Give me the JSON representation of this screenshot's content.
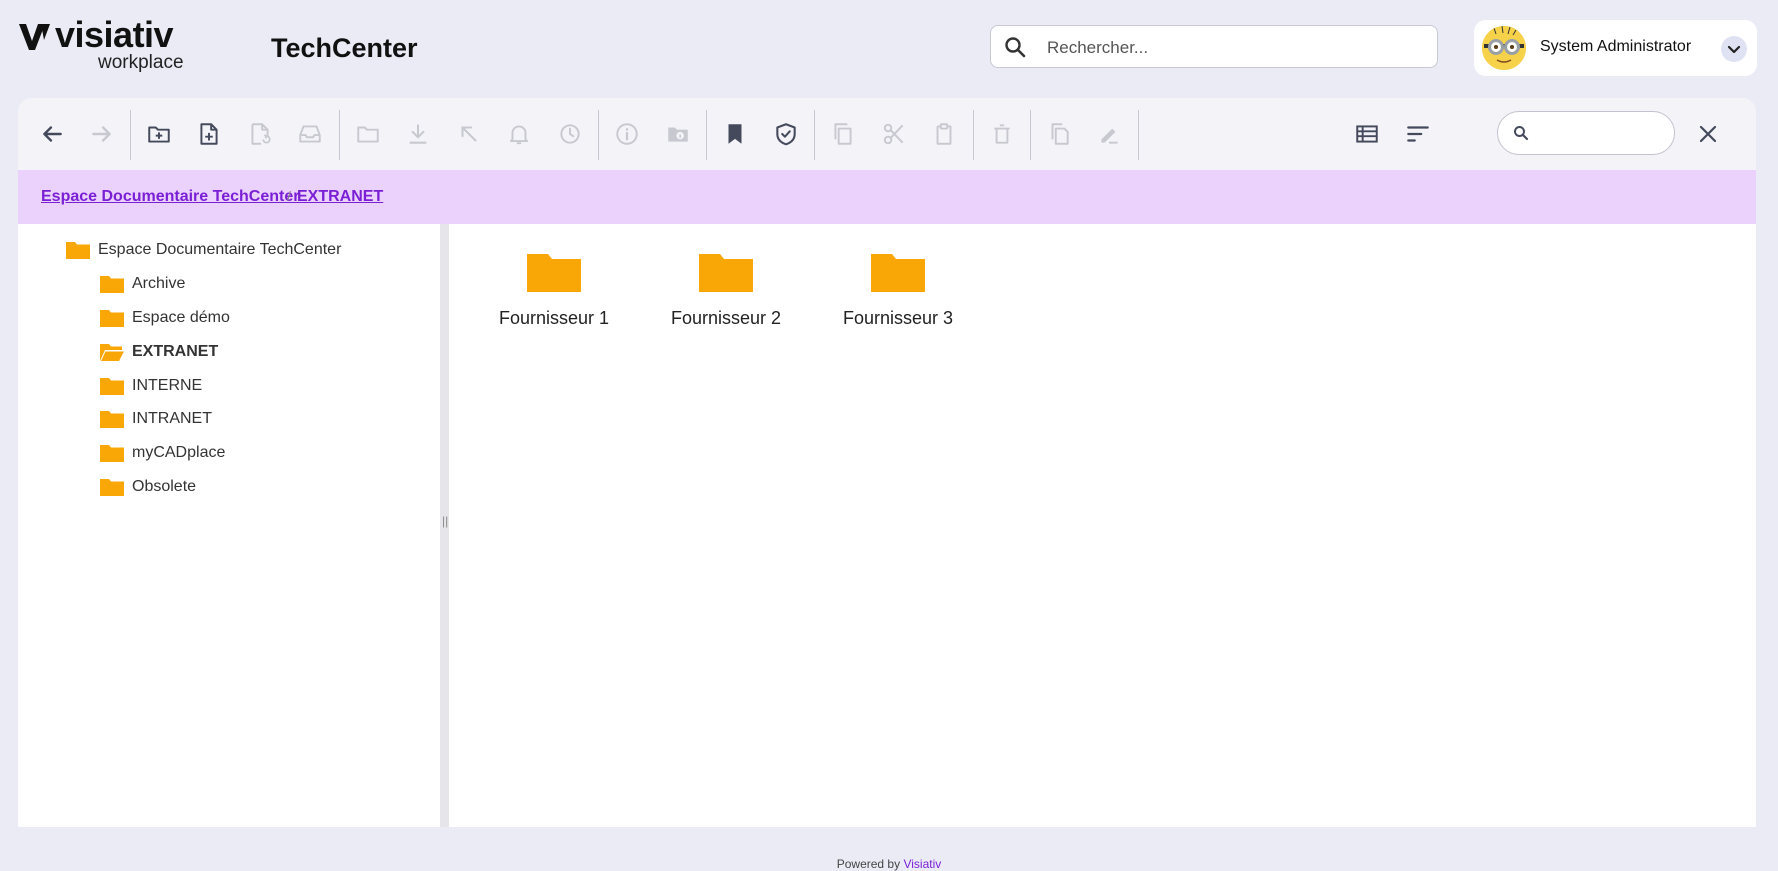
{
  "brand": {
    "word": "visiativ",
    "sub": "workplace"
  },
  "app_title": "TechCenter",
  "search": {
    "placeholder": "Rechercher..."
  },
  "user": {
    "name": "System Administrator"
  },
  "filter": {
    "placeholder": ""
  },
  "breadcrumb": [
    {
      "label": "Espace Documentaire TechCenter"
    },
    {
      "label": "EXTRANET"
    }
  ],
  "tree": {
    "root": "Espace Documentaire TechCenter",
    "items": [
      {
        "label": "Archive"
      },
      {
        "label": "Espace démo"
      },
      {
        "label": "EXTRANET"
      },
      {
        "label": "INTERNE"
      },
      {
        "label": "INTRANET"
      },
      {
        "label": "myCADplace"
      },
      {
        "label": "Obsolete"
      }
    ],
    "selected": "EXTRANET"
  },
  "folders": [
    {
      "label": "Fournisseur 1"
    },
    {
      "label": "Fournisseur 2"
    },
    {
      "label": "Fournisseur 3"
    }
  ],
  "footer": {
    "prefix": "Powered by",
    "link": "Visiativ"
  },
  "colors": {
    "accent": "#7a1fd6",
    "folder": "#f9a706",
    "breadcrumb_bg": "#ebd2fc",
    "icon_active": "#444a5c",
    "icon_disabled": "#c8c8d0"
  },
  "toolbar_icons": [
    "back-icon",
    "forward-icon",
    "new-folder-icon",
    "new-document-icon",
    "replace-document-icon",
    "archive-tray-icon",
    "folder-outline-icon",
    "download-icon",
    "move-up-icon",
    "bell-icon",
    "history-icon",
    "info-icon",
    "folder-info-icon",
    "bookmark-icon",
    "shield-check-icon",
    "copy-icon",
    "cut-icon",
    "paste-icon",
    "delete-icon",
    "duplicate-icon",
    "edit-icon",
    "list-view-icon",
    "sort-icon",
    "close-icon"
  ]
}
